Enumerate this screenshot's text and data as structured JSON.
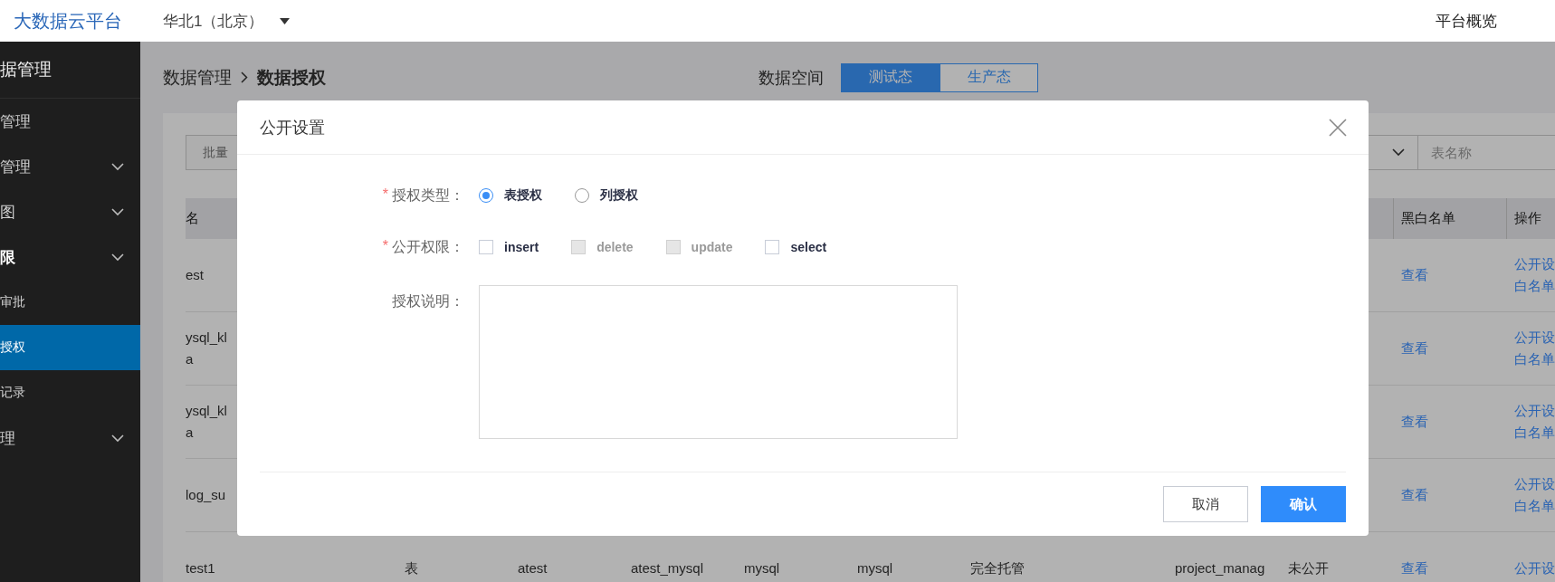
{
  "topbar": {
    "logo": "大数据云平台",
    "region": "华北1（北京）",
    "nav": "平台概览"
  },
  "sidebar": {
    "title": "据管理",
    "items": [
      {
        "label": "管理",
        "kind": "link",
        "expanded": false,
        "selected": false
      },
      {
        "label": "管理",
        "kind": "menu",
        "expanded": false,
        "selected": false
      },
      {
        "label": "图",
        "kind": "menu",
        "expanded": false,
        "selected": false
      },
      {
        "label": "限",
        "kind": "menu",
        "expanded": true,
        "selected": false
      },
      {
        "label": "审批",
        "kind": "child",
        "expanded": false,
        "selected": false
      },
      {
        "label": "授权",
        "kind": "child",
        "expanded": false,
        "selected": true
      },
      {
        "label": "记录",
        "kind": "child",
        "expanded": false,
        "selected": false
      },
      {
        "label": "理",
        "kind": "menu",
        "expanded": false,
        "selected": false
      }
    ]
  },
  "breadcrumb": {
    "parent": "数据管理",
    "current": "数据授权"
  },
  "space": {
    "label": "数据空间",
    "options": [
      {
        "label": "测试态",
        "selected": true
      },
      {
        "label": "生产态",
        "selected": false
      }
    ]
  },
  "toolbar": {
    "batch_button": "批量",
    "search": {
      "placeholder": "表名称"
    }
  },
  "table": {
    "columns": [
      "名",
      null,
      null,
      null,
      null,
      null,
      null,
      null,
      null,
      "黑白名单",
      "操作"
    ],
    "rows": [
      {
        "cells": [
          "est",
          null,
          null,
          null,
          null,
          null,
          null,
          null,
          null,
          "查看",
          [
            "公开设",
            "白名单"
          ]
        ]
      },
      {
        "cells": [
          "ysql_kl\na",
          null,
          null,
          null,
          null,
          null,
          null,
          null,
          null,
          "查看",
          [
            "公开设",
            "白名单"
          ]
        ]
      },
      {
        "cells": [
          "ysql_kl\na",
          null,
          null,
          null,
          null,
          null,
          null,
          null,
          null,
          "查看",
          [
            "公开设",
            "白名单"
          ]
        ]
      },
      {
        "cells": [
          "log_su",
          null,
          null,
          null,
          null,
          null,
          null,
          null,
          null,
          "查看",
          [
            "公开设",
            "白名单"
          ]
        ]
      },
      {
        "cells": [
          "test1",
          "表",
          "atest",
          "atest_mysql",
          "mysql",
          "mysql",
          "完全托管",
          "project_manag",
          "未公开",
          "查看",
          [
            "公开设"
          ]
        ]
      }
    ]
  },
  "modal": {
    "title": "公开设置",
    "fields": [
      {
        "kind": "radio",
        "required_mark": "*",
        "label": "授权类型：",
        "options": [
          {
            "label": "表授权",
            "selected": true
          },
          {
            "label": "列授权",
            "selected": false
          }
        ]
      },
      {
        "kind": "checkbox",
        "required_mark": "*",
        "label": "公开权限：",
        "options": [
          {
            "label": "insert",
            "checked": false,
            "disabled": false
          },
          {
            "label": "delete",
            "checked": false,
            "disabled": true
          },
          {
            "label": "update",
            "checked": false,
            "disabled": true
          },
          {
            "label": "select",
            "checked": false,
            "disabled": false
          }
        ]
      },
      {
        "kind": "textarea",
        "label": "授权说明："
      }
    ],
    "buttons": [
      {
        "label": "取消",
        "kind": "secondary"
      },
      {
        "label": "确认",
        "kind": "primary"
      }
    ]
  }
}
